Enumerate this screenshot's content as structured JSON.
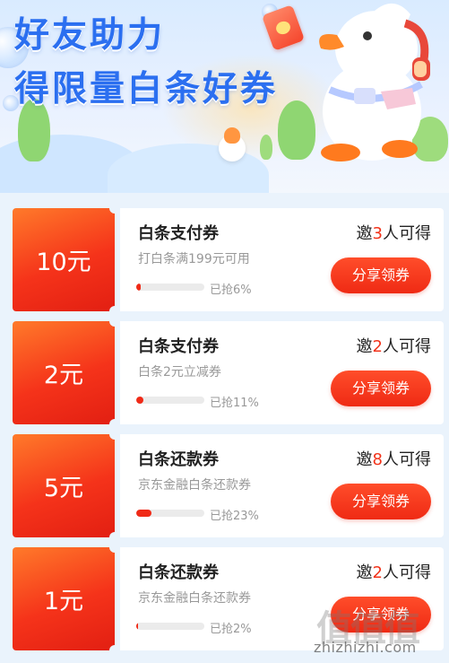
{
  "banner": {
    "title_line1": "好友助力",
    "title_line2": "得限量白条好券"
  },
  "coupons": [
    {
      "amount": "10元",
      "name": "白条支付券",
      "desc": "打白条满199元可用",
      "progress": 0.06,
      "progress_text": "已抢6%",
      "invite_prefix": "邀",
      "invite_count": "3",
      "invite_suffix": "人可得",
      "button_label": "分享领券"
    },
    {
      "amount": "2元",
      "name": "白条支付券",
      "desc": "白条2元立减券",
      "progress": 0.11,
      "progress_text": "已抢11%",
      "invite_prefix": "邀",
      "invite_count": "2",
      "invite_suffix": "人可得",
      "button_label": "分享领券"
    },
    {
      "amount": "5元",
      "name": "白条还款券",
      "desc": "京东金融白条还款券",
      "progress": 0.23,
      "progress_text": "已抢23%",
      "invite_prefix": "邀",
      "invite_count": "8",
      "invite_suffix": "人可得",
      "button_label": "分享领券"
    },
    {
      "amount": "1元",
      "name": "白条还款券",
      "desc": "京东金融白条还款券",
      "progress": 0.02,
      "progress_text": "已抢2%",
      "invite_prefix": "邀",
      "invite_count": "2",
      "invite_suffix": "人可得",
      "button_label": "分享领券"
    }
  ],
  "watermark": {
    "logo": "值值值",
    "url": "zhizhizhi.com"
  },
  "colors": {
    "accent_red": "#f2331a",
    "title_blue": "#2b6ff0"
  }
}
